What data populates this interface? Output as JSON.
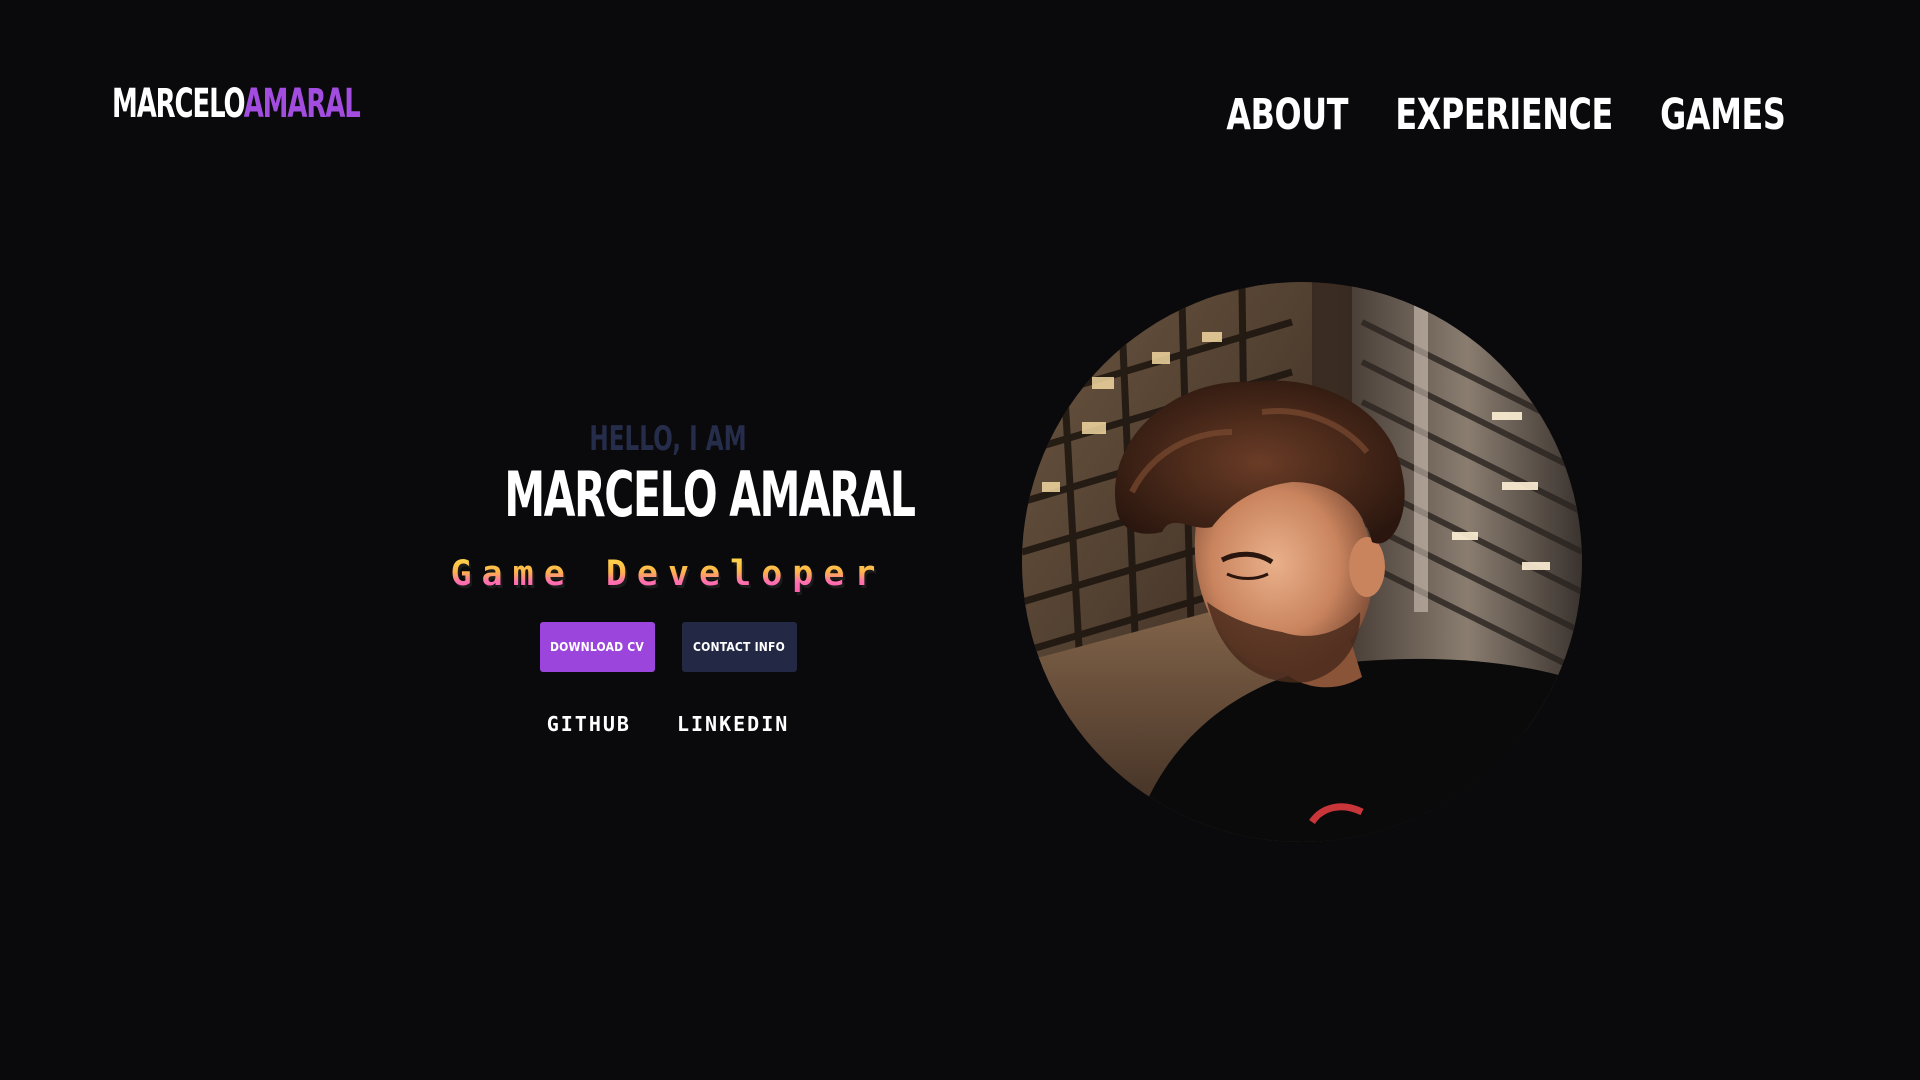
{
  "header": {
    "logo_first": "MARCELO",
    "logo_last": "AMARAL",
    "nav": [
      {
        "label": "ABOUT"
      },
      {
        "label": "EXPERIENCE"
      },
      {
        "label": "GAMES"
      }
    ]
  },
  "hero": {
    "greeting": "HELLO, I AM",
    "name": "MARCELO AMARAL",
    "role": "Game Developer",
    "buttons": {
      "download_cv": "DOWNLOAD CV",
      "contact_info": "CONTACT INFO"
    },
    "socials": [
      {
        "label": "GITHUB"
      },
      {
        "label": "LINKEDIN"
      }
    ]
  },
  "colors": {
    "background": "#0a090b",
    "accent": "#a24de0",
    "secondary_button": "#232945",
    "greeting": "#262d4a"
  },
  "portrait": {
    "icon": "profile-photo"
  }
}
